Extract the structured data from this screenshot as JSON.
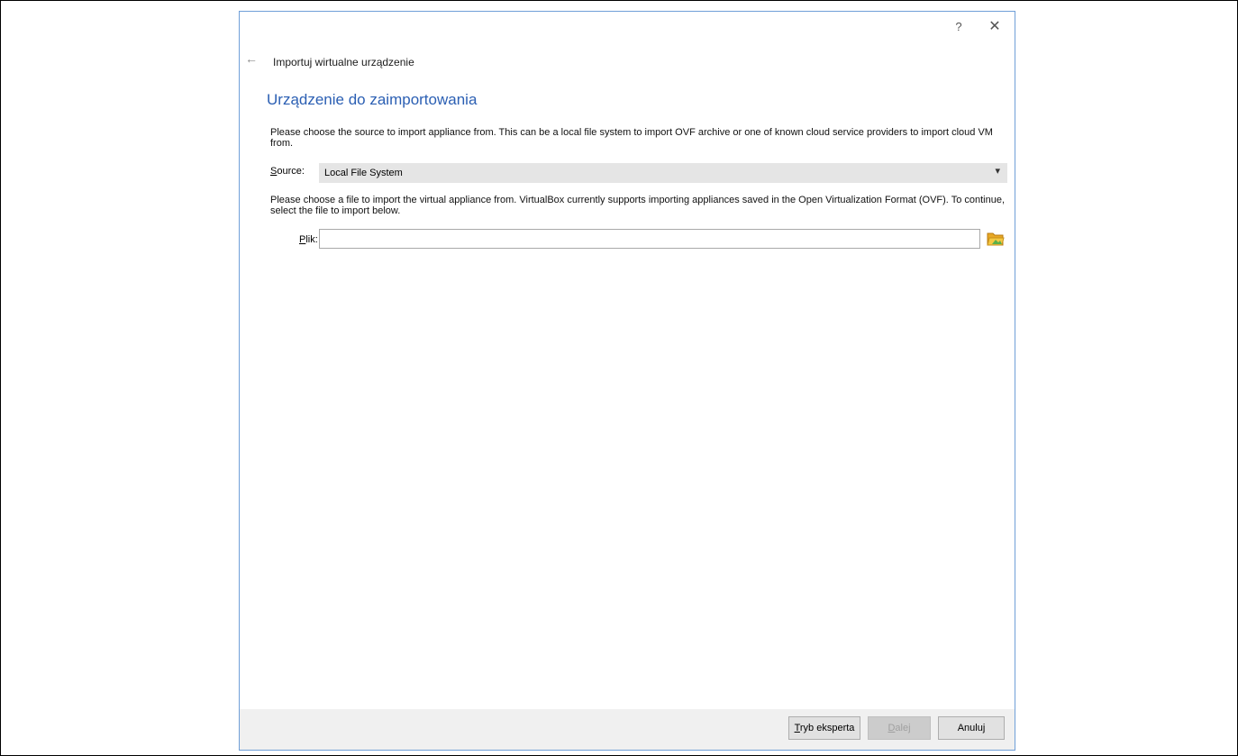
{
  "window": {
    "help_glyph": "?",
    "close_glyph": "✕"
  },
  "header": {
    "back_glyph": "←",
    "wizard_title": "Importuj wirtualne urządzenie",
    "page_title": "Urządzenie do zaimportowania"
  },
  "source_section": {
    "description": "Please choose the source to import appliance from. This can be a local file system to import OVF archive or one of known cloud service providers to import cloud VM from.",
    "label_mnemonic": "S",
    "label_rest": "ource:",
    "selected_value": "Local File System",
    "arrow_glyph": "▾"
  },
  "file_section": {
    "description": "Please choose a file to import the virtual appliance from. VirtualBox currently supports importing appliances saved in the Open Virtualization Format (OVF). To continue, select the file to import below.",
    "label_mnemonic": "P",
    "label_rest": "lik:",
    "value": "",
    "browse_icon": "folder-open-icon"
  },
  "footer": {
    "expert_mnemonic": "T",
    "expert_rest": "ryb eksperta",
    "next_mnemonic": "D",
    "next_rest": "alej",
    "cancel_label": "Anuluj"
  },
  "colors": {
    "accent_title": "#2b5fb3",
    "dialog_border": "#6f9fd8",
    "footer_bg": "#f0f0f0",
    "combo_bg": "#e5e5e5"
  }
}
